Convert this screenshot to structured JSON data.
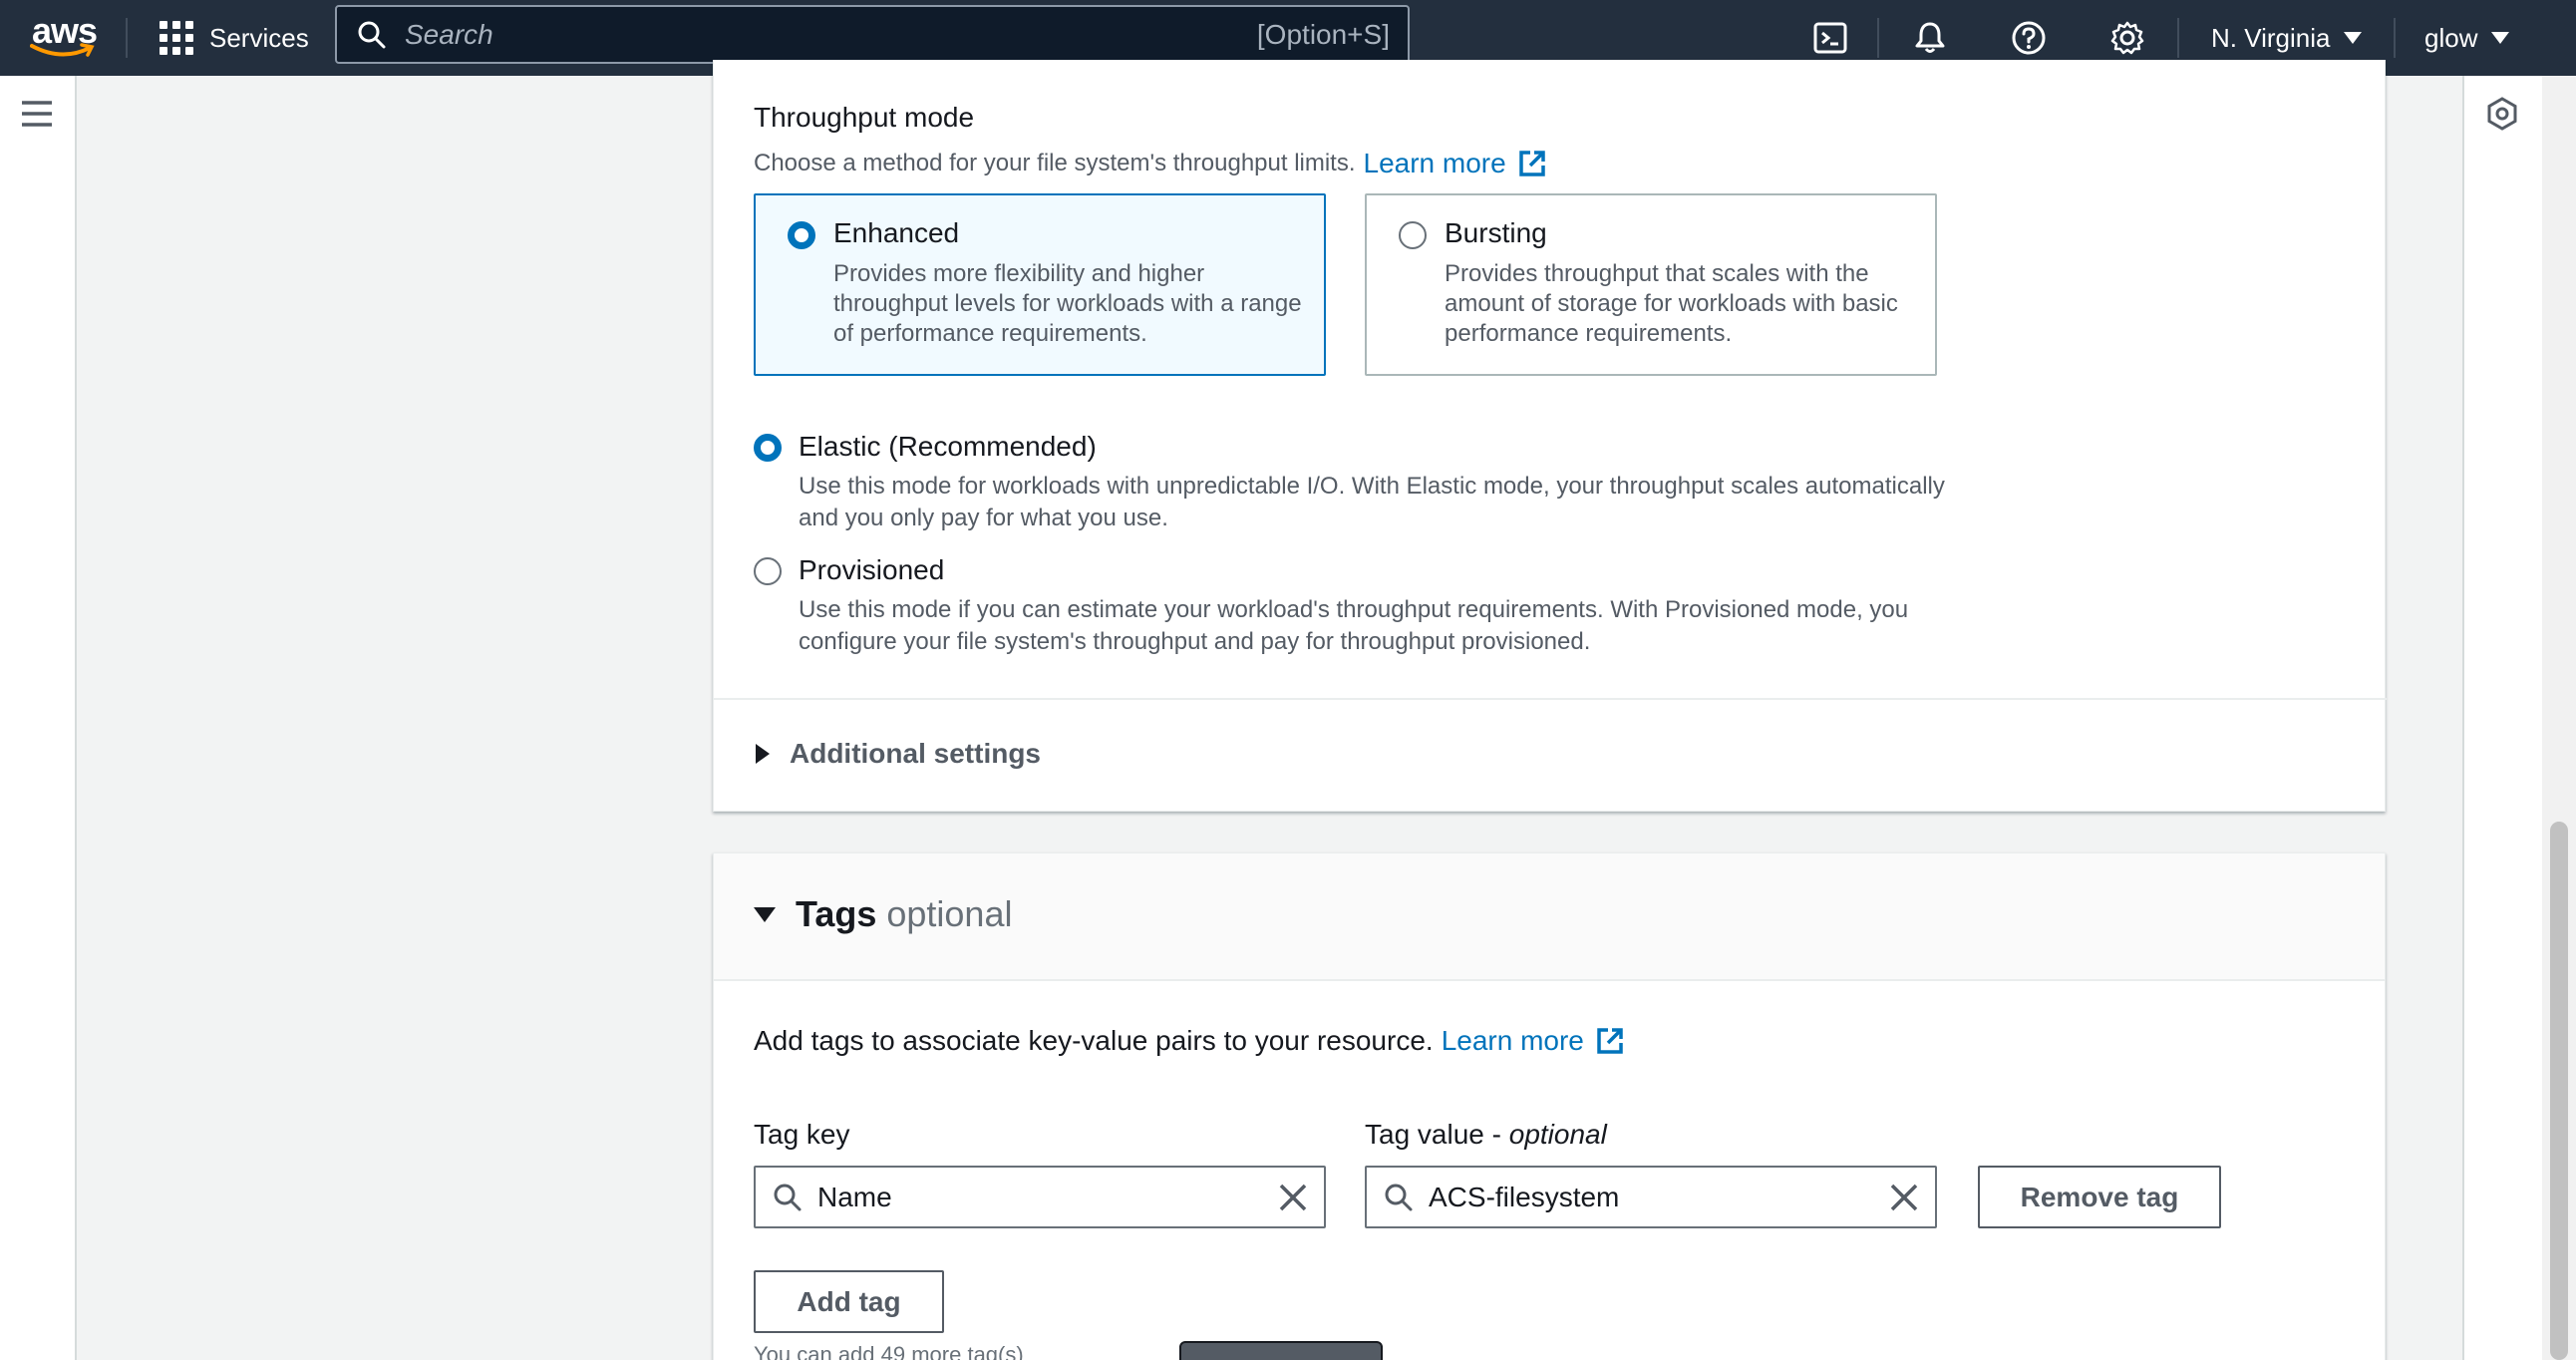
{
  "topnav": {
    "logo_text": "aws",
    "services_label": "Services",
    "search": {
      "placeholder": "Search",
      "shortcut": "[Option+S]"
    },
    "icons": [
      "cloudshell-icon",
      "bell-icon",
      "help-icon",
      "gear-icon"
    ],
    "region": "N. Virginia",
    "user": "glow"
  },
  "throughput": {
    "label": "Throughput mode",
    "description": "Choose a method for your file system's throughput limits.",
    "learn_more": "Learn more",
    "tiles": [
      {
        "title": "Enhanced",
        "desc": "Provides more flexibility and higher throughput levels for workloads with a range of performance requirements.",
        "selected": true
      },
      {
        "title": "Bursting",
        "desc": "Provides throughput that scales with the amount of storage for workloads with basic performance requirements.",
        "selected": false
      }
    ],
    "options": [
      {
        "title": "Elastic (Recommended)",
        "desc": "Use this mode for workloads with unpredictable I/O. With Elastic mode, your throughput scales automatically and you only pay for what you use.",
        "selected": true
      },
      {
        "title": "Provisioned",
        "desc": "Use this mode if you can estimate your workload's throughput requirements. With Provisioned mode, you configure your file system's throughput and pay for throughput provisioned.",
        "selected": false
      }
    ],
    "additional_settings": "Additional settings"
  },
  "tags": {
    "title": "Tags",
    "optional": "optional",
    "description": "Add tags to associate key-value pairs to your resource.",
    "learn_more": "Learn more",
    "tag_key_label": "Tag key",
    "tag_value_label": "Tag value - ",
    "tag_value_optional": "optional",
    "tag_key_value": "Name",
    "tag_value_value": "ACS-filesystem",
    "remove_tag": "Remove tag",
    "add_tag": "Add tag",
    "hint": "You can add 49 more tag(s)"
  },
  "colors": {
    "nav_bg": "#232f3e",
    "link": "#0073bb",
    "selected_bg": "#f1faff"
  }
}
